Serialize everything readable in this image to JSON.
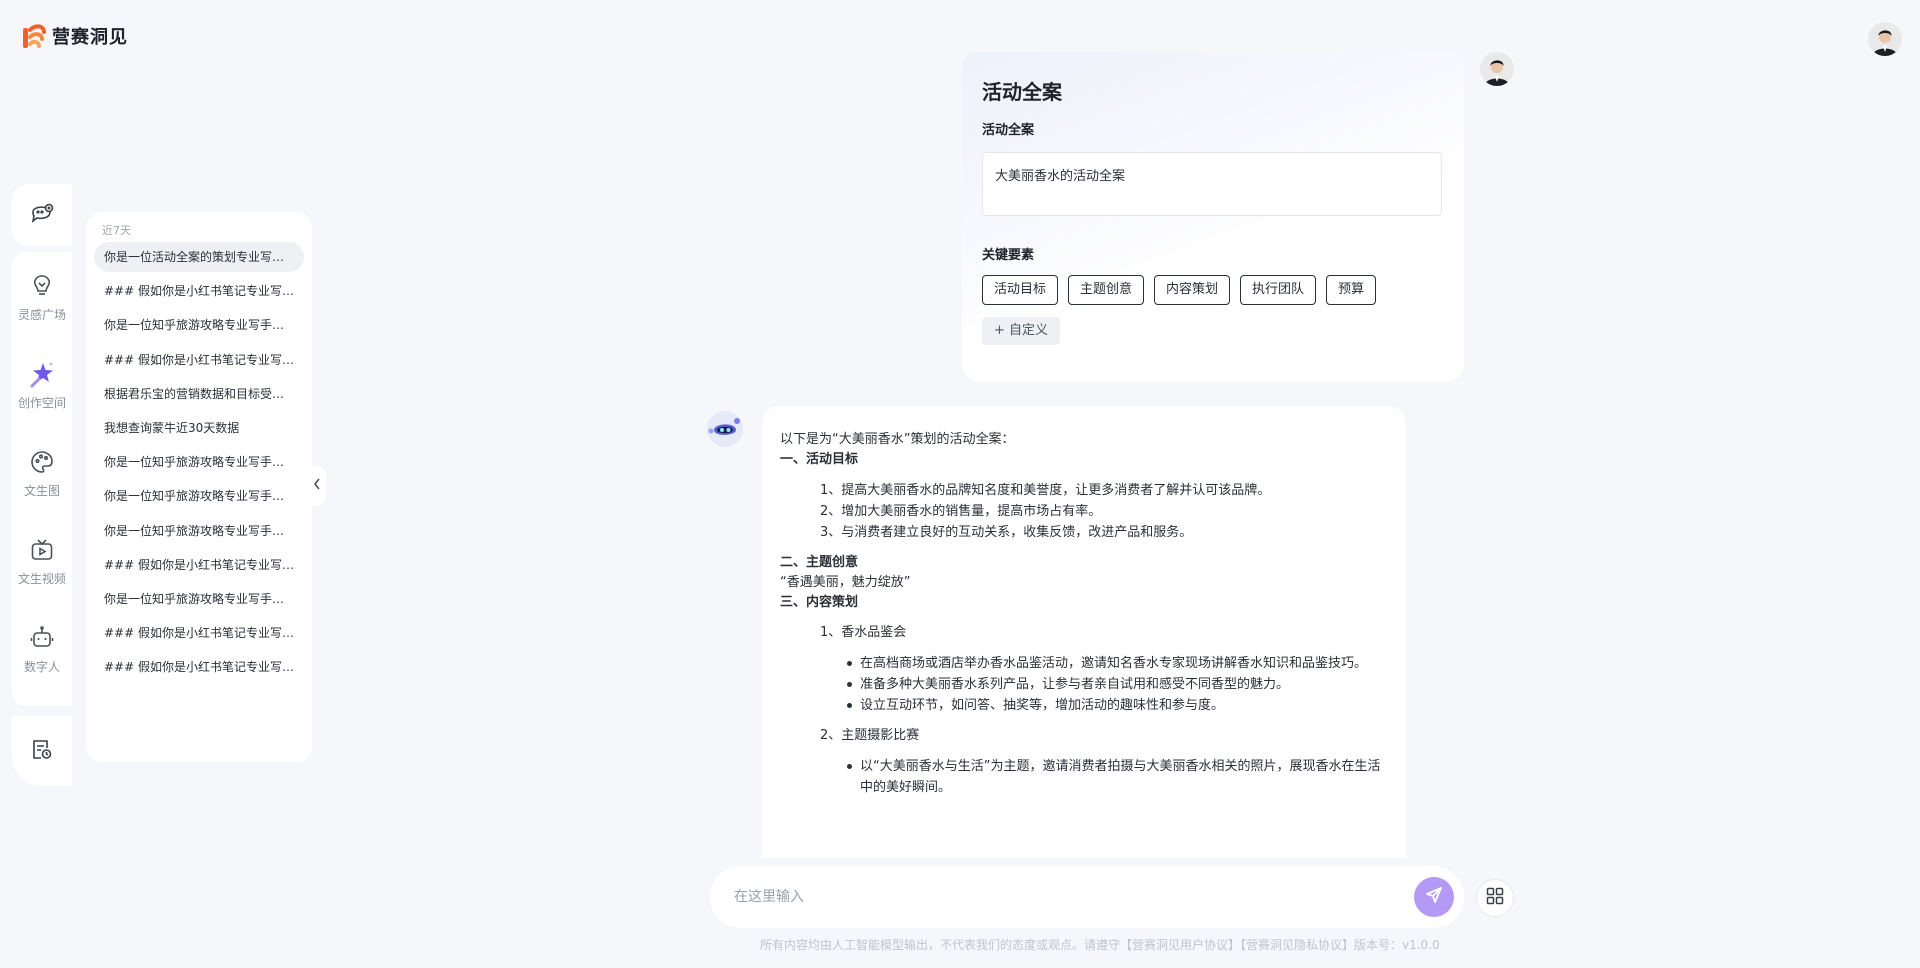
{
  "app": {
    "name": "营赛洞见"
  },
  "rail": {
    "items": [
      {
        "icon": "lightbulb-icon",
        "label": "灵感广场"
      },
      {
        "icon": "magic-star-icon",
        "label": "创作空间"
      },
      {
        "icon": "palette-icon",
        "label": "文生图"
      },
      {
        "icon": "video-icon",
        "label": "文生视频"
      },
      {
        "icon": "robot-icon",
        "label": "数字人"
      }
    ]
  },
  "history": {
    "group_label": "近7天",
    "items": [
      "你是一位活动全案的策划专业写手，...",
      "### 假如你是小红书笔记专业写手...",
      "你是一位知乎旅游攻略专业写手，...",
      "### 假如你是小红书笔记专业写手...",
      "根据君乐宝的营销数据和目标受众...",
      "我想查询蒙牛近30天数据",
      "你是一位知乎旅游攻略专业写手，...",
      "你是一位知乎旅游攻略专业写手，...",
      "你是一位知乎旅游攻略专业写手，...",
      "### 假如你是小红书笔记专业写手...",
      "你是一位知乎旅游攻略专业写手，...",
      "### 假如你是小红书笔记专业写手...",
      "### 假如你是小红书笔记专业写手..."
    ]
  },
  "form": {
    "title": "活动全案",
    "field_label": "活动全案",
    "field_value": "大美丽香水的活动全案",
    "key_label": "关键要素",
    "tags": [
      "活动目标",
      "主题创意",
      "内容策划",
      "执行团队",
      "预算"
    ],
    "add_custom": "+ 自定义"
  },
  "message": {
    "intro": "以下是为“大美丽香水”策划的活动全案：",
    "s1_title": "一、活动目标",
    "s1_items": [
      "1、提高大美丽香水的品牌知名度和美誉度，让更多消费者了解并认可该品牌。",
      "2、增加大美丽香水的销售量，提高市场占有率。",
      "3、与消费者建立良好的互动关系，收集反馈，改进产品和服务。"
    ],
    "s2_title": "二、主题创意",
    "s2_text": "“香遇美丽，魅力绽放”",
    "s3_title": "三、内容策划",
    "s3_sub1": "1、香水品鉴会",
    "s3_sub1_bullets": [
      "在高档商场或酒店举办香水品鉴活动，邀请知名香水专家现场讲解香水知识和品鉴技巧。",
      "准备多种大美丽香水系列产品，让参与者亲自试用和感受不同香型的魅力。",
      "设立互动环节，如问答、抽奖等，增加活动的趣味性和参与度。"
    ],
    "s3_sub2": "2、主题摄影比赛",
    "s3_sub2_bullets": [
      "以“大美丽香水与生活”为主题，邀请消费者拍摄与大美丽香水相关的照片，展现香水在生活中的美好瞬间。"
    ]
  },
  "input": {
    "placeholder": "在这里输入"
  },
  "footer": {
    "text": "所有内容均由人工智能模型输出，不代表我们的态度或观点。请遵守【营赛洞见用户协议】【营赛洞见隐私协议】版本号：v1.0.0"
  },
  "colors": {
    "accent": "#b49af5",
    "brand_orange": "#f2612a"
  }
}
